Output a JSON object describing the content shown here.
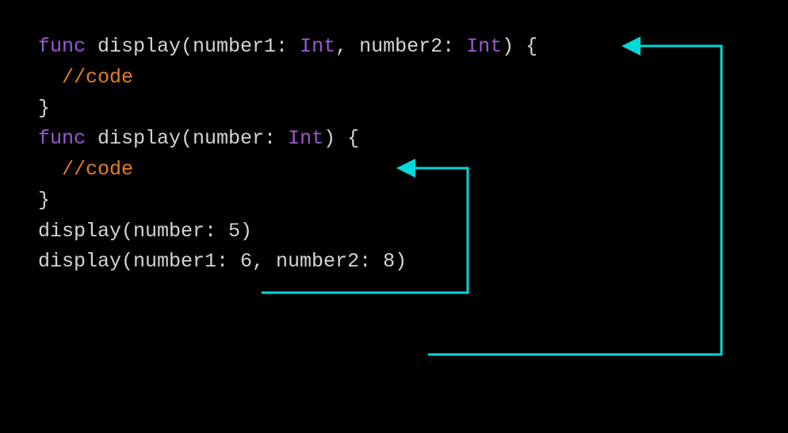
{
  "code": {
    "func1": {
      "keyword": "func",
      "name": " display(number1: ",
      "type1": "Int",
      "mid": ", number2: ",
      "type2": "Int",
      "tail": ") {"
    },
    "comment": "  //code",
    "closebrace": "}",
    "blank": "",
    "func2": {
      "keyword": "func",
      "name": " display(number: ",
      "type": "Int",
      "tail": ") {"
    },
    "call1": "display(number: 5)",
    "call2": "display(number1: 6, number2: 8)"
  },
  "diagram": {
    "arrows": [
      {
        "from": "call1",
        "to": "func2"
      },
      {
        "from": "call2",
        "to": "func1"
      }
    ],
    "color": "#00d9d9"
  }
}
